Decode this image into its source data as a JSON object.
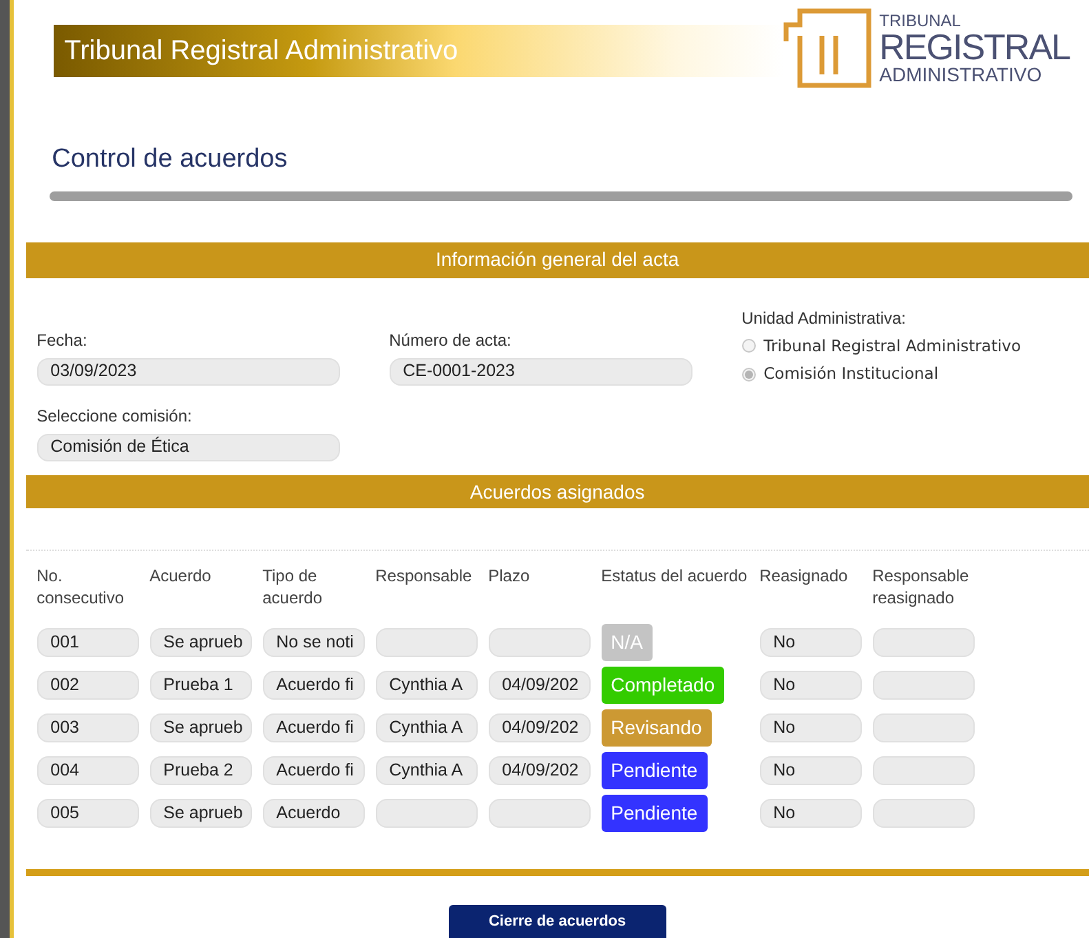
{
  "header": {
    "banner_title": "Tribunal Registral Administrativo",
    "logo_lines": [
      "TRIBUNAL",
      "REGISTRAL",
      "ADMINISTRATIVO"
    ]
  },
  "page_title": "Control de acuerdos",
  "general_section": {
    "title": "Información general del acta",
    "fecha": {
      "label": "Fecha:",
      "value": "03/09/2023"
    },
    "numero_acta": {
      "label": "Número de acta:",
      "value": "CE-0001-2023"
    },
    "comision": {
      "label": "Seleccione comisión:",
      "value": "Comisión de Ética"
    },
    "unidad": {
      "label": "Unidad Administrativa:",
      "options": [
        {
          "label": "Tribunal Registral Administrativo",
          "selected": false
        },
        {
          "label": "Comisión Institucional",
          "selected": true
        }
      ]
    }
  },
  "acuerdos_section": {
    "title": "Acuerdos asignados",
    "columns": [
      "No. consecutivo",
      "Acuerdo",
      "Tipo de acuerdo",
      "Responsable",
      "Plazo",
      "Estatus del acuerdo",
      "Reasignado",
      "Responsable reasignado"
    ],
    "rows": [
      {
        "no": "001",
        "acuerdo": "Se aprueb",
        "tipo": "No se noti",
        "responsable": "",
        "plazo": "",
        "status": {
          "label": "N/A",
          "color": "#c4c4c4"
        },
        "reasignado": "No",
        "responsable_reasignado": ""
      },
      {
        "no": "002",
        "acuerdo": "Prueba 1",
        "tipo": "Acuerdo fi",
        "responsable": "Cynthia A",
        "plazo": "04/09/202",
        "status": {
          "label": "Completado",
          "color": "#33cc00"
        },
        "reasignado": "No",
        "responsable_reasignado": ""
      },
      {
        "no": "003",
        "acuerdo": "Se aprueb",
        "tipo": "Acuerdo fi",
        "responsable": "Cynthia A",
        "plazo": "04/09/202",
        "status": {
          "label": "Revisando",
          "color": "#cc9933"
        },
        "reasignado": "No",
        "responsable_reasignado": ""
      },
      {
        "no": "004",
        "acuerdo": "Prueba 2",
        "tipo": "Acuerdo fi",
        "responsable": "Cynthia A",
        "plazo": "04/09/202",
        "status": {
          "label": "Pendiente",
          "color": "#3333ff"
        },
        "reasignado": "No",
        "responsable_reasignado": ""
      },
      {
        "no": "005",
        "acuerdo": "Se aprueb",
        "tipo": "Acuerdo",
        "responsable": "",
        "plazo": "",
        "status": {
          "label": "Pendiente",
          "color": "#3333ff"
        },
        "reasignado": "No",
        "responsable_reasignado": ""
      }
    ]
  },
  "close_button": "Cierre de acuerdos"
}
